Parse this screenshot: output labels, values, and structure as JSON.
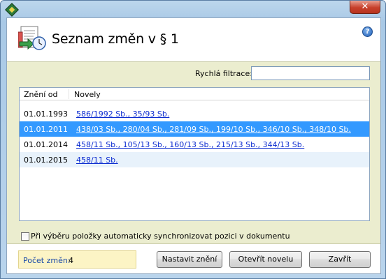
{
  "window": {
    "close_glyph": "✕"
  },
  "header": {
    "title": "Seznam změn v § 1",
    "help_glyph": "?"
  },
  "filter": {
    "label": "Rychlá filtrace:",
    "value": ""
  },
  "table": {
    "columns": [
      "Znění od",
      "Novely"
    ],
    "rows": [
      {
        "date": "01.01.1993",
        "novely": "586/1992 Sb., 35/93 Sb.",
        "selected": false
      },
      {
        "date": "01.01.2011",
        "novely": "438/03 Sb., 280/04 Sb., 281/09 Sb., 199/10 Sb., 346/10 Sb., 348/10 Sb.",
        "selected": true
      },
      {
        "date": "01.01.2014",
        "novely": "458/11 Sb., 105/13 Sb., 160/13 Sb., 215/13 Sb., 344/13 Sb.",
        "selected": false
      },
      {
        "date": "01.01.2015",
        "novely": "458/11 Sb.",
        "selected": false
      }
    ]
  },
  "sync": {
    "label": "Při výběru položky automaticky synchronizovat pozici v dokumentu",
    "checked": false
  },
  "footer": {
    "count_label": "Počet změn:",
    "count_value": "4",
    "buttons": {
      "set": "Nastavit znění",
      "open": "Otevřít novelu",
      "close": "Zavřít"
    }
  },
  "colors": {
    "selection": "#3399ff",
    "link": "#0b2bd0",
    "panel_bg": "#ebedcf",
    "count_bg": "#fcf4c5"
  },
  "icons": [
    "app-icon",
    "close-icon",
    "document-history-icon",
    "help-icon"
  ]
}
